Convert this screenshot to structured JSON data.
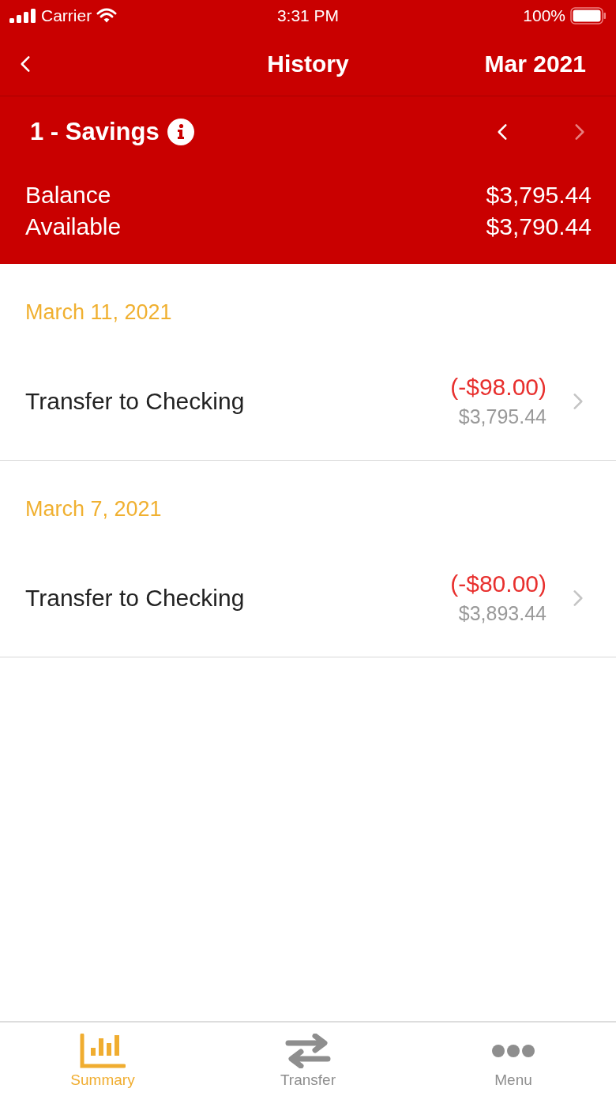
{
  "status_bar": {
    "carrier": "Carrier",
    "time": "3:31 PM",
    "battery": "100%"
  },
  "nav": {
    "title": "History",
    "period": "Mar 2021"
  },
  "account": {
    "name": "1 - Savings",
    "prev_disabled": false,
    "next_disabled": true
  },
  "balances": [
    {
      "label": "Balance",
      "amount": "$3,795.44"
    },
    {
      "label": "Available",
      "amount": "$3,790.44"
    }
  ],
  "groups": [
    {
      "date": "March 11, 2021",
      "transactions": [
        {
          "description": "Transfer to Checking",
          "amount": "(-$98.00)",
          "balance": "$3,795.44"
        }
      ]
    },
    {
      "date": "March 7, 2021",
      "transactions": [
        {
          "description": "Transfer to Checking",
          "amount": "(-$80.00)",
          "balance": "$3,893.44"
        }
      ]
    }
  ],
  "tabs": [
    {
      "label": "Summary",
      "kind": "summary",
      "selected": true
    },
    {
      "label": "Transfer",
      "kind": "transfer",
      "selected": false
    },
    {
      "label": "Menu",
      "kind": "menu",
      "selected": false
    }
  ]
}
